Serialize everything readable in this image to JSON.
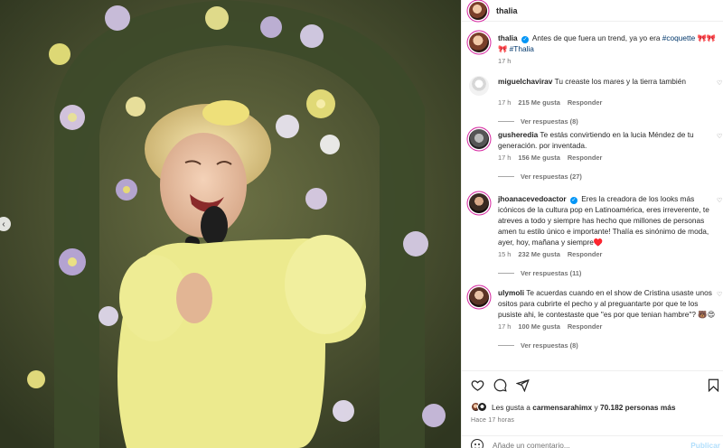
{
  "header": {
    "username": "thalia"
  },
  "caption": {
    "username": "thalia",
    "text": "Antes de que fuera un trend, ya yo era",
    "hashtag1": "#coquette",
    "text2": "🎀🎀🎀",
    "hashtag2": "#Thalia",
    "time": "17 h"
  },
  "comments": [
    {
      "username": "miguelchavirav",
      "text": "Tu creaste los mares y la tierra también",
      "time": "17 h",
      "likes": "215 Me gusta",
      "reply": "Responder",
      "view_replies": "Ver respuestas (8)"
    },
    {
      "username": "gusheredia",
      "text": "Te estás convirtiendo en la lucia Méndez de tu generación. por inventada.",
      "time": "17 h",
      "likes": "156 Me gusta",
      "reply": "Responder",
      "view_replies": "Ver respuestas (27)"
    },
    {
      "username": "jhoanacevedoactor",
      "text": "Eres la creadora de los looks más icónicos de la cultura pop en Latinoamérica, eres irreverente, te atreves a todo y siempre has hecho que millones de personas amen tu estilo único e importante! Thalía es sinónimo de moda, ayer, hoy, mañana y siempre♥️",
      "time": "15 h",
      "likes": "232 Me gusta",
      "reply": "Responder",
      "view_replies": "Ver respuestas (11)"
    },
    {
      "username": "ulymoli",
      "text": "Te acuerdas cuando en el show de Cristina usaste unos ositos para cubrirte el pecho y al preguantarte por que te los pusiste ahi, le contestaste que \"es por que tenian hambre\"? 🐻😍",
      "time": "17 h",
      "likes": "100 Me gusta",
      "reply": "Responder",
      "view_replies": "Ver respuestas (8)"
    }
  ],
  "likes": {
    "prefix": "Les gusta a",
    "user": "carmensarahimx",
    "middle": "y",
    "count": "70.182 personas más"
  },
  "posted": "Hace 17 horas",
  "add_comment": {
    "placeholder": "Añade un comentario...",
    "post": "Publicar"
  },
  "icons": {
    "like": "heart-icon",
    "comment": "comment-icon",
    "share": "share-icon",
    "save": "bookmark-icon",
    "verified": "verified-badge-icon",
    "carousel": "chevron-left-icon",
    "emoji": "emoji-icon"
  },
  "colors": {
    "link": "#00376b",
    "verified": "#0095f6",
    "muted": "#737373",
    "post_disabled": "#b2dffc"
  }
}
